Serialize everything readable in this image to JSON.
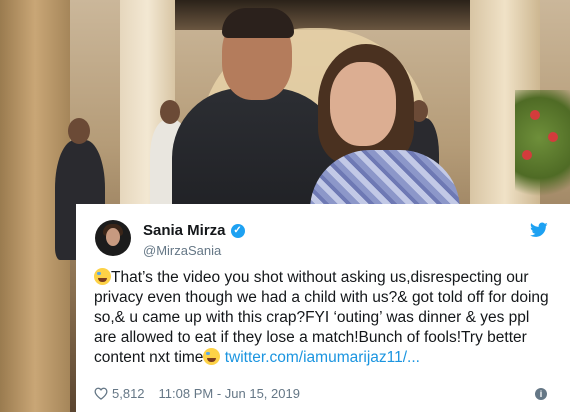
{
  "tweet": {
    "name": "Sania Mirza",
    "handle": "@MirzaSania",
    "text_part1": "That’s the video you shot without asking us,disrespecting our privacy even though we had a child with us?& got told off for doing so,& u came up with this crap?FYI ‘outing’ was dinner & yes ppl are allowed to eat if they lose a match!Bunch of fools!Try better content nxt time",
    "link": "twitter.com/iamumarijaz11/...",
    "likes": "5,812",
    "timestamp": "11:08 PM - Jun 15, 2019",
    "verified_color": "#1da1f2",
    "link_color": "#1b95e0",
    "icons": [
      "verified-badge-icon",
      "twitter-bird-icon",
      "tears-of-joy-emoji-icon",
      "heart-icon",
      "info-icon"
    ]
  }
}
